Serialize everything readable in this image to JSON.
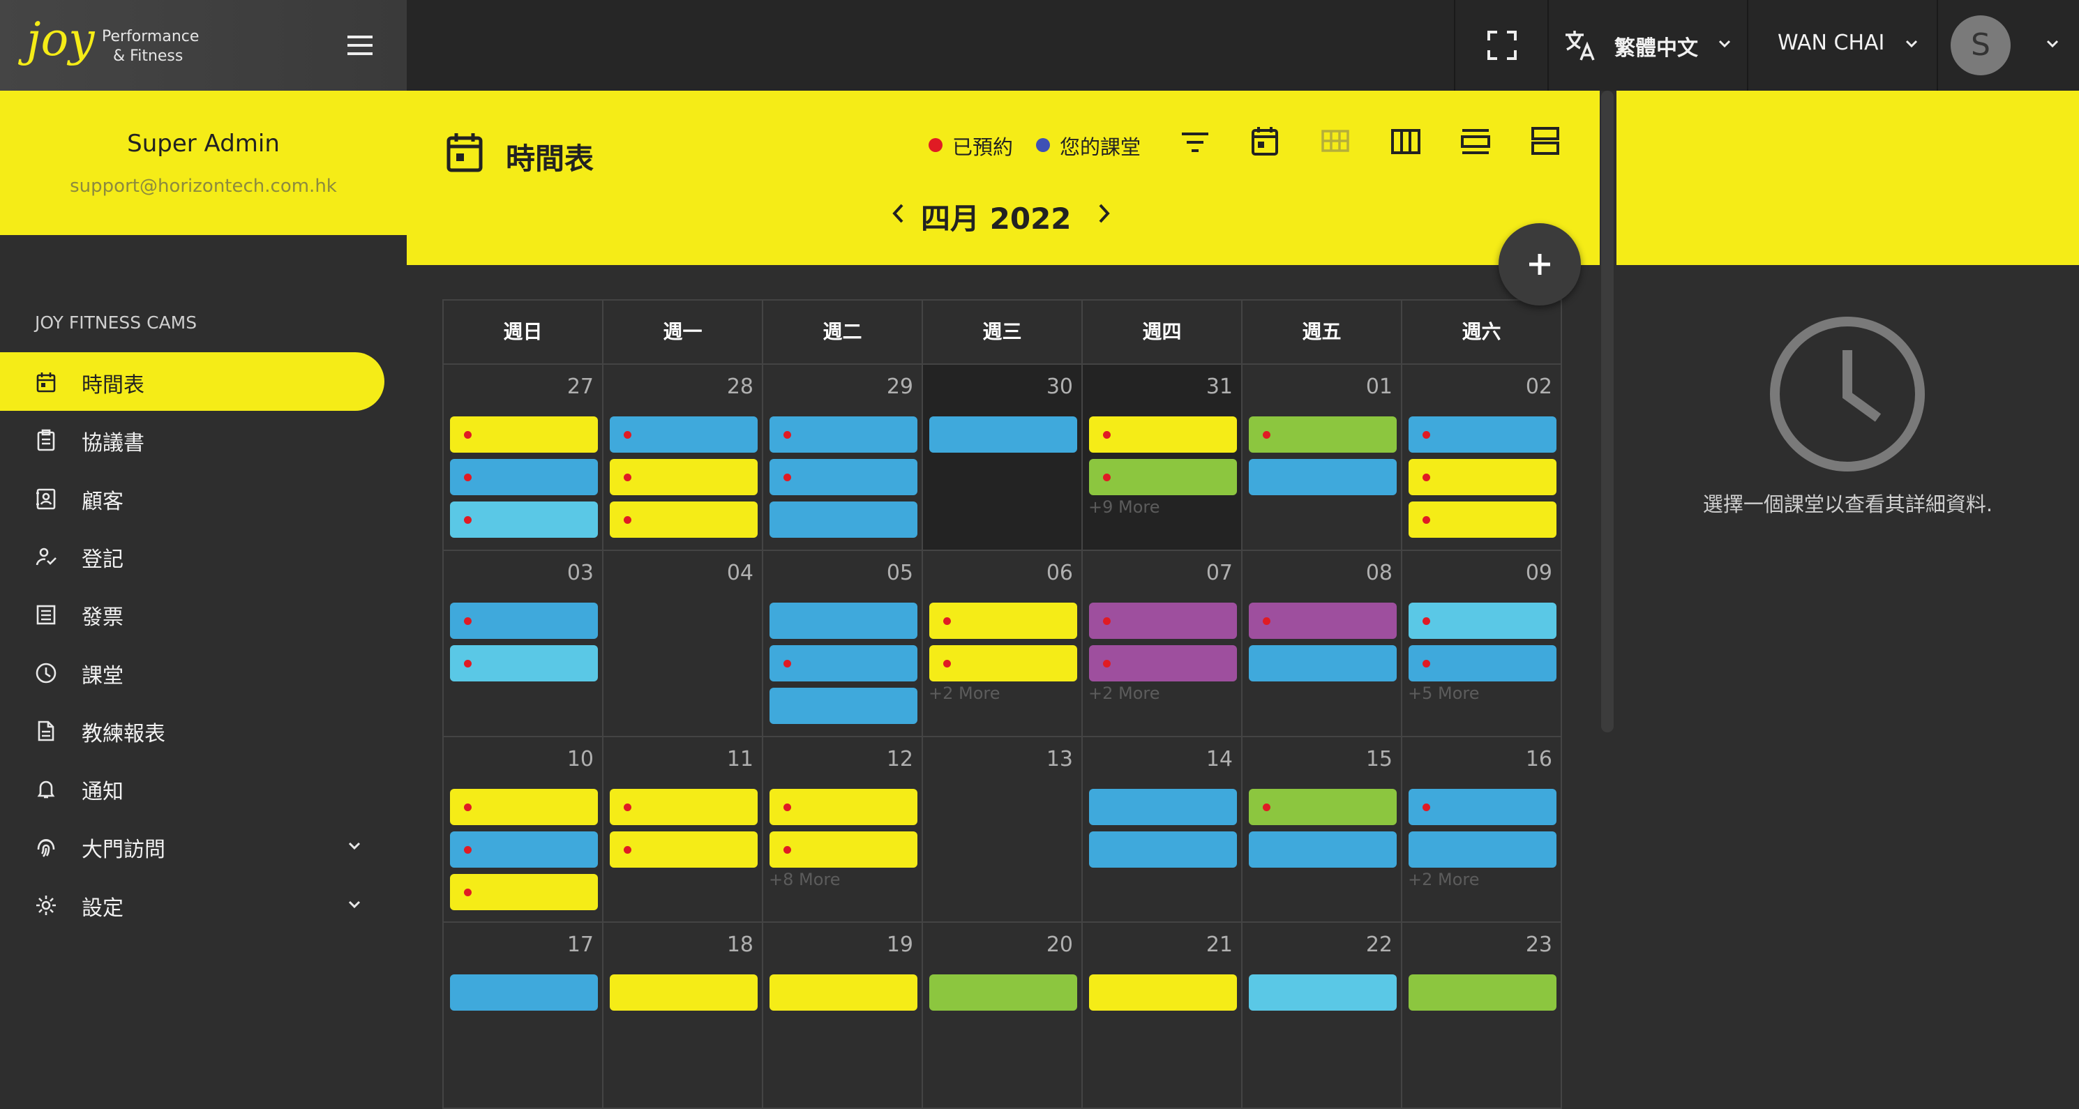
{
  "brand": {
    "logo_word": "joy",
    "tagline_line1": "Performance",
    "tagline_line2": "& Fitness"
  },
  "topbar": {
    "language": "繁體中文",
    "location": "WAN CHAI",
    "avatar_initial": "S"
  },
  "profile": {
    "name": "Super Admin",
    "email": "support@horizontech.com.hk"
  },
  "sidebar": {
    "section_title": "JOY FITNESS CAMS",
    "items": [
      {
        "label": "時間表",
        "icon": "calendar-icon",
        "active": true
      },
      {
        "label": "協議書",
        "icon": "clipboard-icon"
      },
      {
        "label": "顧客",
        "icon": "contact-card-icon"
      },
      {
        "label": "登記",
        "icon": "user-check-icon"
      },
      {
        "label": "發票",
        "icon": "invoice-list-icon"
      },
      {
        "label": "課堂",
        "icon": "clock-icon"
      },
      {
        "label": "教練報表",
        "icon": "document-icon"
      },
      {
        "label": "通知",
        "icon": "bell-icon"
      },
      {
        "label": "大門訪問",
        "icon": "fingerprint-icon",
        "expandable": true
      },
      {
        "label": "設定",
        "icon": "gear-icon",
        "expandable": true
      }
    ]
  },
  "main": {
    "title": "時間表",
    "month_label": "四月 2022",
    "legend": {
      "booked": "已預約",
      "your_classes": "您的課堂"
    },
    "colors": {
      "accent": "#f5ec17",
      "booked_dot": "#e01b24",
      "your_class_dot": "#3f51b5"
    }
  },
  "calendar": {
    "weekdays": [
      "週日",
      "週一",
      "週二",
      "週三",
      "週四",
      "週五",
      "週六"
    ],
    "event_colors": {
      "yellow": "#f5ec17",
      "blue": "#3fa9dc",
      "lightblue": "#5ac8e6",
      "green": "#8cc63f",
      "purple": "#9e4f9e"
    },
    "weeks": [
      [
        {
          "day": "27",
          "events": [
            [
              "yellow",
              true
            ],
            [
              "blue",
              true
            ],
            [
              "lightblue",
              true
            ]
          ]
        },
        {
          "day": "28",
          "events": [
            [
              "blue",
              true
            ],
            [
              "yellow",
              true
            ],
            [
              "yellow",
              true
            ]
          ]
        },
        {
          "day": "29",
          "events": [
            [
              "blue",
              true
            ],
            [
              "blue",
              true
            ],
            [
              "blue",
              false
            ]
          ]
        },
        {
          "day": "30",
          "events": [
            [
              "blue",
              false
            ]
          ],
          "dark": true
        },
        {
          "day": "31",
          "events": [
            [
              "yellow",
              true
            ],
            [
              "green",
              true
            ]
          ],
          "more": "+9 More",
          "dark": true
        },
        {
          "day": "01",
          "events": [
            [
              "green",
              true
            ],
            [
              "blue",
              false
            ]
          ]
        },
        {
          "day": "02",
          "events": [
            [
              "blue",
              true
            ],
            [
              "yellow",
              true
            ],
            [
              "yellow",
              true
            ]
          ]
        }
      ],
      [
        {
          "day": "03",
          "events": [
            [
              "blue",
              true
            ],
            [
              "lightblue",
              true
            ]
          ]
        },
        {
          "day": "04",
          "events": []
        },
        {
          "day": "05",
          "events": [
            [
              "blue",
              false
            ],
            [
              "blue",
              true
            ],
            [
              "blue",
              false
            ]
          ]
        },
        {
          "day": "06",
          "events": [
            [
              "yellow",
              true
            ],
            [
              "yellow",
              true
            ]
          ],
          "more": "+2 More"
        },
        {
          "day": "07",
          "events": [
            [
              "purple",
              true
            ],
            [
              "purple",
              true
            ]
          ],
          "more": "+2 More"
        },
        {
          "day": "08",
          "events": [
            [
              "purple",
              true
            ],
            [
              "blue",
              false
            ]
          ]
        },
        {
          "day": "09",
          "events": [
            [
              "lightblue",
              true
            ],
            [
              "blue",
              true
            ]
          ],
          "more": "+5 More"
        }
      ],
      [
        {
          "day": "10",
          "events": [
            [
              "yellow",
              true
            ],
            [
              "blue",
              true
            ],
            [
              "yellow",
              true
            ]
          ]
        },
        {
          "day": "11",
          "events": [
            [
              "yellow",
              true
            ],
            [
              "yellow",
              true
            ]
          ]
        },
        {
          "day": "12",
          "events": [
            [
              "yellow",
              true
            ],
            [
              "yellow",
              true
            ]
          ],
          "more": "+8 More"
        },
        {
          "day": "13",
          "events": []
        },
        {
          "day": "14",
          "events": [
            [
              "blue",
              false
            ],
            [
              "blue",
              false
            ]
          ]
        },
        {
          "day": "15",
          "events": [
            [
              "green",
              true
            ],
            [
              "blue",
              false
            ]
          ]
        },
        {
          "day": "16",
          "events": [
            [
              "blue",
              true
            ],
            [
              "blue",
              false
            ]
          ],
          "more": "+2 More"
        }
      ],
      [
        {
          "day": "17",
          "events": [
            [
              "blue",
              false
            ]
          ]
        },
        {
          "day": "18",
          "events": [
            [
              "yellow",
              false
            ]
          ]
        },
        {
          "day": "19",
          "events": [
            [
              "yellow",
              false
            ]
          ]
        },
        {
          "day": "20",
          "events": [
            [
              "green",
              false
            ]
          ]
        },
        {
          "day": "21",
          "events": [
            [
              "yellow",
              false
            ]
          ]
        },
        {
          "day": "22",
          "events": [
            [
              "lightblue",
              false
            ]
          ]
        },
        {
          "day": "23",
          "events": [
            [
              "green",
              false
            ]
          ]
        }
      ]
    ]
  },
  "detail_panel": {
    "empty_message": "選擇一個課堂以查看其詳細資料."
  }
}
